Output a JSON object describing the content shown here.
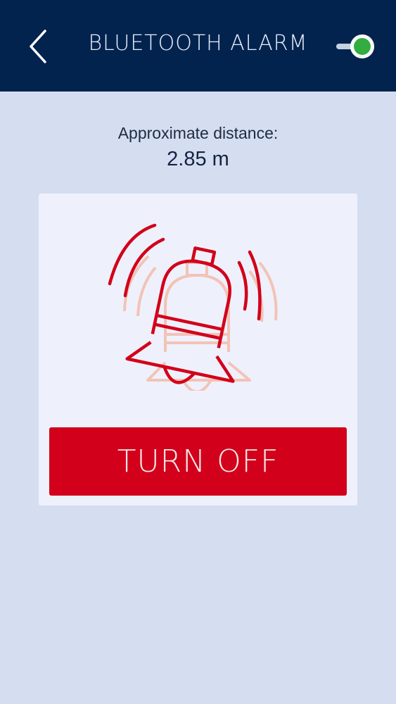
{
  "header": {
    "title": "BLUETOOTH ALARM",
    "toggle_on": true
  },
  "main": {
    "distance_label": "Approximate distance:",
    "distance_value": "2.85 m",
    "turn_off_label": "TURN OFF"
  },
  "colors": {
    "header_bg": "#03234f",
    "background": "#d5def0",
    "card_bg": "#eef1fb",
    "alarm_red": "#d2001a",
    "bell_echo": "#f3c3b7",
    "toggle_on": "#33ad3f"
  },
  "icons": {
    "back": "chevron-left-icon",
    "toggle": "toggle-switch-icon",
    "alarm": "ringing-bell-icon"
  }
}
